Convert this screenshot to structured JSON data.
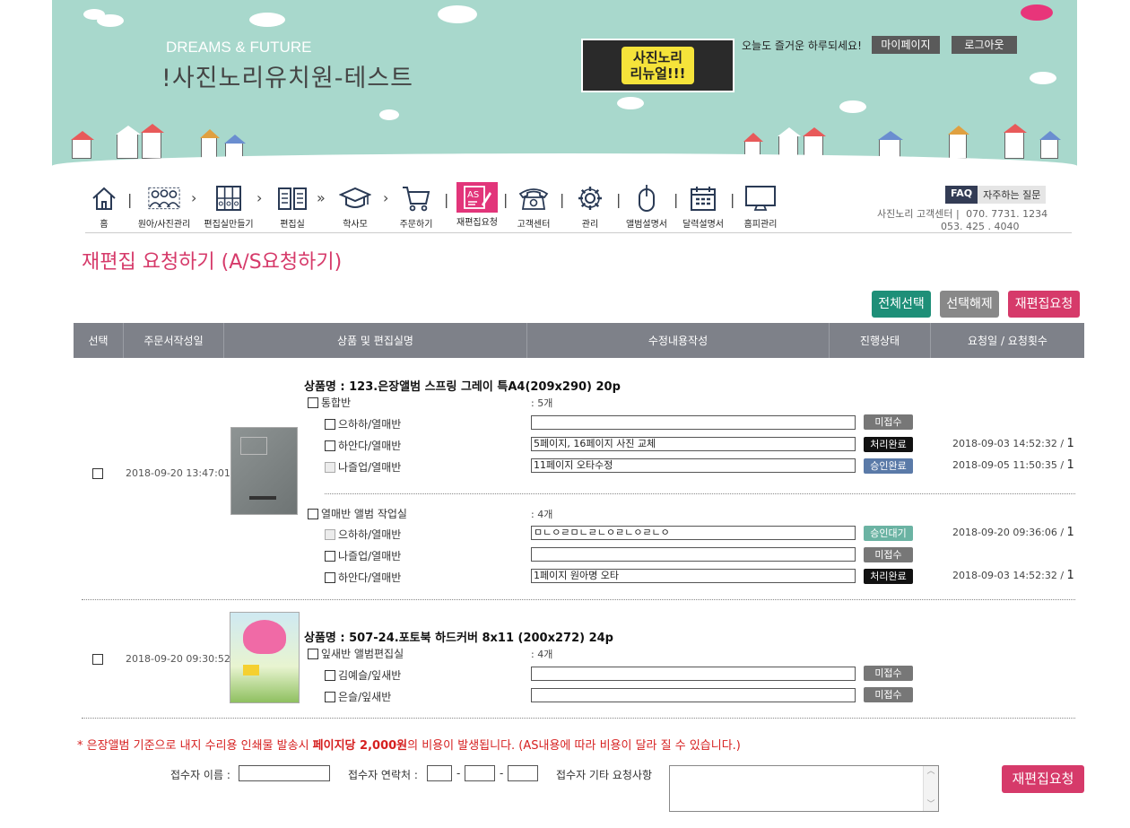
{
  "header": {
    "brand_small": "DREAMS & FUTURE",
    "brand_big": "!사진노리유치원-테스트",
    "promo_line1": "사진노리",
    "promo_line2": "리뉴얼!!!",
    "greeting": "오늘도 즐거운 하루되세요!",
    "mypage": "마이페이지",
    "logout": "로그아웃"
  },
  "nav": [
    {
      "label": "홈",
      "icon": "home-icon"
    },
    {
      "label": "원아/사진관리",
      "icon": "people-icon"
    },
    {
      "label": "편집실만들기",
      "icon": "grid-icon"
    },
    {
      "label": "편집실",
      "icon": "book-icon"
    },
    {
      "label": "학사모",
      "icon": "graduation-cap-icon"
    },
    {
      "label": "주문하기",
      "icon": "cart-icon"
    },
    {
      "label": "재편집요청",
      "icon": "as-edit-icon"
    },
    {
      "label": "고객센터",
      "icon": "phone-icon"
    },
    {
      "label": "관리",
      "icon": "gear-icon"
    },
    {
      "label": "앨범설명서",
      "icon": "mouse-icon"
    },
    {
      "label": "달력설명서",
      "icon": "calendar-icon"
    },
    {
      "label": "홈피관리",
      "icon": "monitor-icon"
    }
  ],
  "support": {
    "faq": "FAQ",
    "faq_text": "자주하는 질문",
    "center_label": "사진노리 고객센터 |",
    "phone1": "070. 7731. 1234",
    "phone2": "053. 425 . 4040"
  },
  "page_title": "재편집 요청하기 (A/S요청하기)",
  "actions": {
    "select_all": "전체선택",
    "deselect": "선택해제",
    "request": "재편집요청"
  },
  "table_headers": [
    "선택",
    "주문서작성일",
    "상품 및 편집실명",
    "수정내용작성",
    "진행상태",
    "요청일 / 요청횟수"
  ],
  "orders": [
    {
      "date": "2018-09-20 13:47:01",
      "product": "상품명 : 123.은장앨범 스프링 그레이 특A4(209x290) 20p",
      "groups": [
        {
          "name": "통합반",
          "count": ": 5개",
          "items": [
            {
              "name": "으하하/열매반",
              "text": "",
              "status": "미접수",
              "req": "",
              "times": ""
            },
            {
              "name": "하안다/열매반",
              "text": "5페이지, 16페이지 사진 교체",
              "status": "처리완료",
              "req": "2018-09-03 14:52:32 / ",
              "times": "1"
            },
            {
              "name": "나즐업/열매반",
              "text": "11페이지 오타수정",
              "status": "승인완료",
              "req": "2018-09-05 11:50:35 / ",
              "times": "1"
            }
          ]
        },
        {
          "name": "열매반 앨범 작업실",
          "count": ": 4개",
          "items": [
            {
              "name": "으하하/열매반",
              "text": "ㅁㄴㅇㄹㅁㄴㄹㄴㅇㄹㄴㅇㄹㄴㅇ",
              "status": "승인대기",
              "req": "2018-09-20 09:36:06 / ",
              "times": "1"
            },
            {
              "name": "나즐업/열매반",
              "text": "",
              "status": "미접수",
              "req": "",
              "times": ""
            },
            {
              "name": "하안다/열매반",
              "text": "1페이지 원아명 오타",
              "status": "처리완료",
              "req": "2018-09-03 14:52:32 / ",
              "times": "1"
            }
          ]
        }
      ]
    },
    {
      "date": "2018-09-20 09:30:52",
      "product": "상품명 : 507-24.포토북 하드커버 8x11 (200x272) 24p",
      "groups": [
        {
          "name": "잎새반 앨범편집실",
          "count": ": 4개",
          "items": [
            {
              "name": "김예슬/잎새반",
              "text": "",
              "status": "미접수"
            },
            {
              "name": "은슬/잎새반",
              "text": "",
              "status": "미접수"
            }
          ]
        }
      ]
    }
  ],
  "notice_pre": "* 은장앨범 기준으로 내지 수리용 인쇄물 발송시 ",
  "notice_bold": "페이지당 2,000원",
  "notice_post": "의 비용이 발생됩니다. (AS내용에 따라 비용이 달라 질 수 있습니다.)",
  "form": {
    "name_label": "접수자 이름 :",
    "contact_label": "접수자 연락처 :",
    "dash": "-",
    "etc_label": "접수자 기타 요청사항",
    "submit": "재편집요청"
  },
  "colors": {
    "banner": "#a8d8cc",
    "accent_pink": "#d63a6a",
    "green_btn": "#1e8f78",
    "gray_btn": "#888888",
    "header_gray": "#7e8189"
  }
}
